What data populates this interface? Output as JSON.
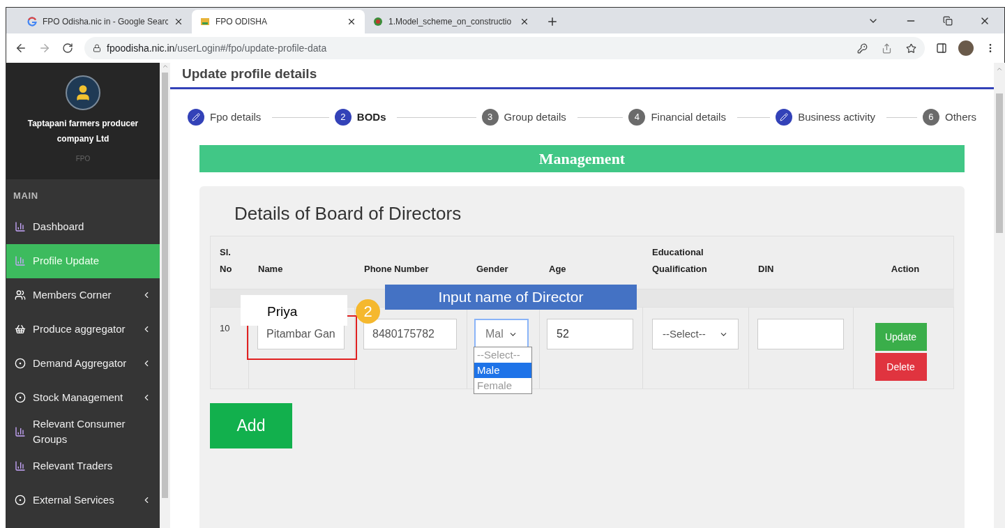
{
  "browser": {
    "tabs": [
      {
        "title": "FPO Odisha.nic in - Google Searc",
        "kind": "google",
        "selected": false
      },
      {
        "title": "FPO ODISHA",
        "kind": "site",
        "selected": true
      },
      {
        "title": "1.Model_scheme_on_constructio",
        "kind": "emblem",
        "selected": false
      }
    ],
    "url_host": "fpoodisha.nic.in",
    "url_path": "/userLogin#/fpo/update-profile-data"
  },
  "sidebar": {
    "org_name": "Taptapani farmers producer company Ltd",
    "org_type": "FPO",
    "section": "MAIN",
    "items": [
      {
        "label": "Dashboard",
        "kind": "chart",
        "selected": false,
        "expandable": false
      },
      {
        "label": "Profile Update",
        "kind": "chart",
        "selected": true,
        "expandable": false
      },
      {
        "label": "Members Corner",
        "kind": "users",
        "selected": false,
        "expandable": true
      },
      {
        "label": "Produce aggregator",
        "kind": "basket",
        "selected": false,
        "expandable": true
      },
      {
        "label": "Demand Aggregator",
        "kind": "circle",
        "selected": false,
        "expandable": true
      },
      {
        "label": "Stock Management",
        "kind": "circle",
        "selected": false,
        "expandable": true
      },
      {
        "label": "Relevant Consumer Groups",
        "kind": "chart",
        "selected": false,
        "expandable": false
      },
      {
        "label": "Relevant Traders",
        "kind": "chart",
        "selected": false,
        "expandable": false
      },
      {
        "label": "External Services",
        "kind": "circle",
        "selected": false,
        "expandable": true
      }
    ]
  },
  "page": {
    "heading": "Update profile details",
    "steps": [
      {
        "label": "Fpo details",
        "done": true,
        "selected": false
      },
      {
        "number": "2",
        "label": "BODs",
        "done": false,
        "selected": true
      },
      {
        "number": "3",
        "label": "Group details",
        "done": false,
        "selected": false
      },
      {
        "number": "4",
        "label": "Financial details",
        "done": false,
        "selected": false
      },
      {
        "label": "Business activity",
        "done": true,
        "selected": false
      },
      {
        "number": "6",
        "label": "Others",
        "done": false,
        "selected": false
      }
    ],
    "banner": "Management",
    "card_title": "Details of Board of Directors",
    "columns": [
      [
        "Sl.",
        "No"
      ],
      [
        "Name"
      ],
      [
        "Phone Number"
      ],
      [
        "Gender"
      ],
      [
        "Age"
      ],
      [
        "Educational",
        "Qualification"
      ],
      [
        "DIN"
      ],
      [
        "Action"
      ]
    ],
    "rows": [
      {
        "sl": "10",
        "name": "Pitambar Gan",
        "phone": "8480175782",
        "gender": "Mal",
        "age": "52",
        "education": "--Select--",
        "din": "",
        "actions": [
          "Update",
          "Delete"
        ]
      }
    ],
    "gender_options": [
      {
        "label": "--Select--",
        "selected": false
      },
      {
        "label": "Male",
        "selected": true
      },
      {
        "label": "Female",
        "selected": false
      }
    ],
    "add_button": "Add"
  },
  "annotations": {
    "callout": "Input name of Director",
    "label": "Priya",
    "step_badge": "2"
  }
}
